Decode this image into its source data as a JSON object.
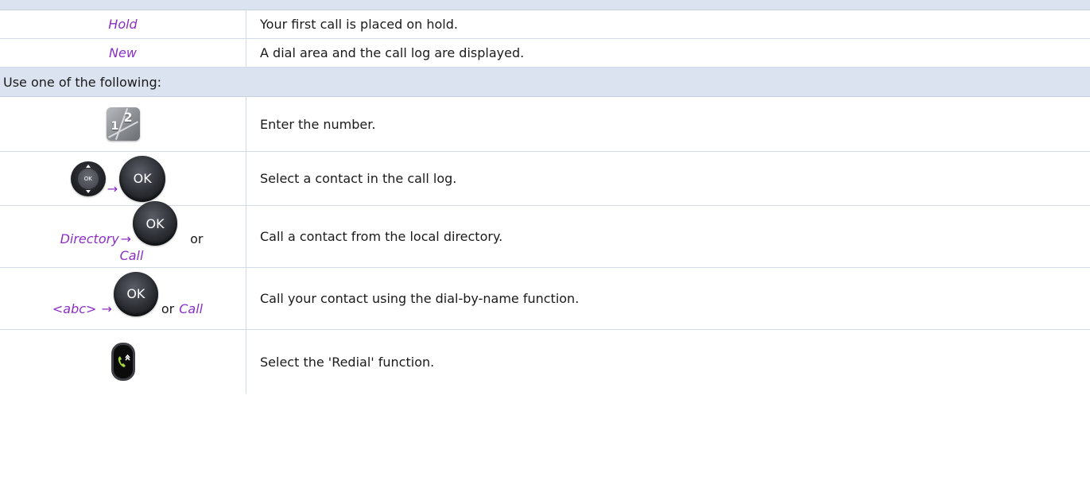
{
  "rows": [
    {
      "left": "Hold",
      "right": "Your first call is placed on hold."
    },
    {
      "left": "New",
      "right": "A dial area and the call log are displayed."
    }
  ],
  "use_one": "Use one of the following:",
  "options": {
    "keypad": {
      "icon": "keypad-icon",
      "key1": "1",
      "key2": "2",
      "text": "Enter the number."
    },
    "navigator": {
      "icon": "navigator-ok-icon",
      "inner_label": "OK",
      "arrow": "→",
      "ok_label": "OK",
      "text": "Select a contact in the call log."
    },
    "directory": {
      "label": "Directory",
      "arrow": "→",
      "ok_label": "OK",
      "or": "or",
      "call": "Call",
      "text": "Call a contact from the local directory."
    },
    "dial_by_name": {
      "label": "<abc>",
      "arrow": "→",
      "ok_label": "OK",
      "or": "or",
      "call": "Call",
      "text": "Call your contact using the dial-by-name function."
    },
    "redial": {
      "icon": "redial-key-icon",
      "text": "Select the 'Redial' function."
    }
  },
  "colors": {
    "banner_bg": "#dae3ef",
    "softkey_text": "#8a2fc4",
    "border": "#d3dbe6",
    "redial_green": "#a6d63a"
  }
}
